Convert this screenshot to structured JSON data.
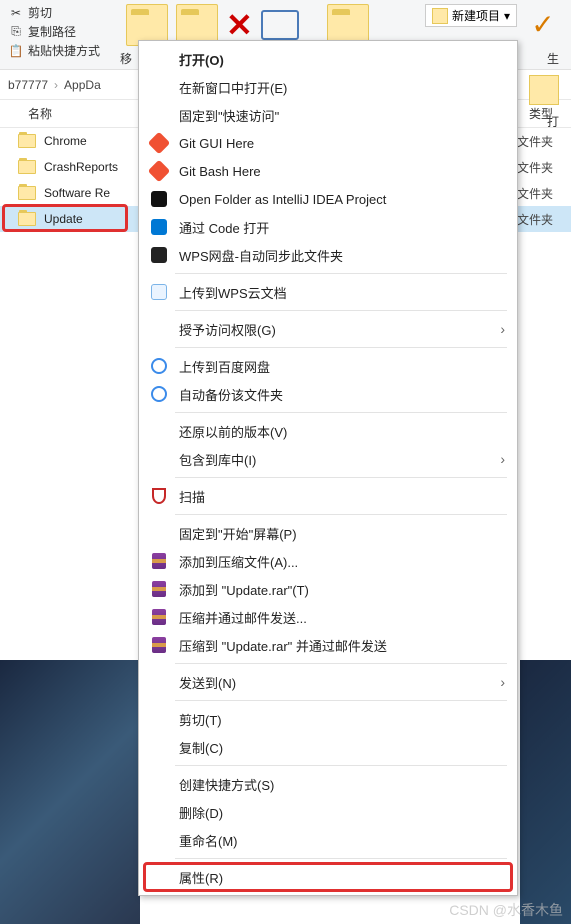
{
  "ribbon": {
    "cut": "剪切",
    "copy_path": "复制路径",
    "paste_shortcut": "粘贴快捷方式",
    "move": "移",
    "new_item": "新建项目",
    "right_side": "生",
    "open_label": "打"
  },
  "breadcrumb": {
    "seg1": "b77777",
    "seg2": "AppDa"
  },
  "columns": {
    "name": "名称",
    "type": "类型"
  },
  "list": [
    {
      "name": "Chrome",
      "type": "文件夹",
      "selected": false
    },
    {
      "name": "CrashReports",
      "type": "文件夹",
      "selected": false
    },
    {
      "name": "Software Re",
      "type": "文件夹",
      "selected": false
    },
    {
      "name": "Update",
      "type": "文件夹",
      "selected": true
    }
  ],
  "type_label": "文件夹",
  "menu": {
    "open": "打开(O)",
    "open_new": "在新窗口中打开(E)",
    "pin_quick": "固定到\"快速访问\"",
    "git_gui": "Git GUI Here",
    "git_bash": "Git Bash Here",
    "idea": "Open Folder as IntelliJ IDEA Project",
    "vscode": "通过 Code 打开",
    "wps_sync": "WPS网盘-自动同步此文件夹",
    "wps_upload": "上传到WPS云文档",
    "grant": "授予访问权限(G)",
    "baidu_upload": "上传到百度网盘",
    "baidu_backup": "自动备份该文件夹",
    "restore": "还原以前的版本(V)",
    "include": "包含到库中(I)",
    "scan": "扫描",
    "pin_start": "固定到\"开始\"屏幕(P)",
    "rar_add": "添加到压缩文件(A)...",
    "rar_update": "添加到 \"Update.rar\"(T)",
    "rar_email": "压缩并通过邮件发送...",
    "rar_update_email": "压缩到 \"Update.rar\" 并通过邮件发送",
    "sendto": "发送到(N)",
    "cut": "剪切(T)",
    "copy": "复制(C)",
    "shortcut": "创建快捷方式(S)",
    "delete": "删除(D)",
    "rename": "重命名(M)",
    "properties": "属性(R)"
  },
  "watermark": "CSDN @水香木鱼"
}
